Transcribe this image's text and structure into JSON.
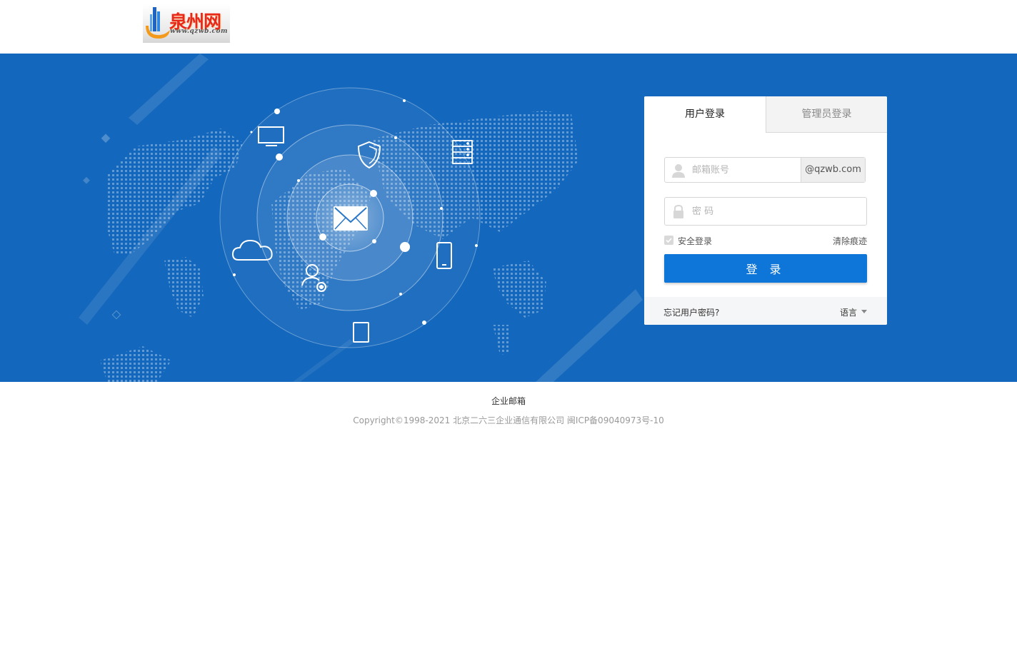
{
  "header": {
    "logo_text": "泉州网",
    "logo_url_text": "www.qzwb.com"
  },
  "login": {
    "tabs": [
      {
        "label": "用户登录",
        "active": true
      },
      {
        "label": "管理员登录",
        "active": false
      }
    ],
    "account": {
      "placeholder": "邮箱账号",
      "value": "",
      "domain": "@qzwb.com"
    },
    "password": {
      "placeholder": "密 码",
      "value": ""
    },
    "secure_login": {
      "label": "安全登录",
      "checked": true
    },
    "clear_traces_label": "清除痕迹",
    "submit_label": "登 录",
    "forgot_label": "忘记用户密码?",
    "language_label": "语言"
  },
  "footer": {
    "title": "企业邮箱",
    "copyright": "Copyright©1998-2021 北京二六三企业通信有限公司 闽ICP备09040973号-10"
  },
  "colors": {
    "banner": "#1367bc",
    "primary_button": "#0d76d8",
    "logo_red": "#e8281a"
  },
  "icons": [
    "person-icon",
    "lock-icon",
    "envelope-icon",
    "shield-icon",
    "monitor-icon",
    "server-icon",
    "cloud-icon",
    "user-settings-icon",
    "phone-icon",
    "tablet-icon",
    "caret-down-icon",
    "check-icon"
  ]
}
